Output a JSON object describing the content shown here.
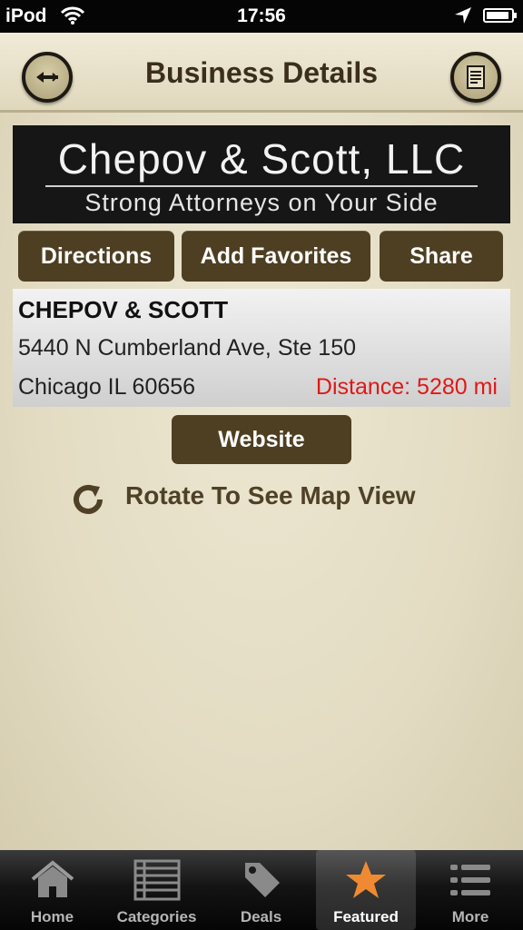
{
  "status_bar": {
    "carrier": "iPod",
    "time": "17:56",
    "wifi_icon": "wifi-icon",
    "location_icon": "location-arrow-icon",
    "battery_icon": "battery-icon"
  },
  "navbar": {
    "title": "Business Details",
    "back_icon": "back-arrow-icon",
    "notes_icon": "notes-icon"
  },
  "banner": {
    "name": "Chepov & Scott, LLC",
    "tagline": "Strong Attorneys on Your Side"
  },
  "actions": {
    "directions": "Directions",
    "add_favorites": "Add Favorites",
    "share": "Share"
  },
  "business": {
    "name": "CHEPOV & SCOTT",
    "address_line1": "5440 N Cumberland Ave, Ste 150",
    "address_line2": "Chicago IL 60656",
    "distance": "Distance: 5280 mi"
  },
  "website_label": "Website",
  "rotate_hint": "Rotate To See Map View",
  "tabs": [
    {
      "label": "Home",
      "icon": "home-icon"
    },
    {
      "label": "Categories",
      "icon": "list-grid-icon"
    },
    {
      "label": "Deals",
      "icon": "tag-icon"
    },
    {
      "label": "Featured",
      "icon": "star-icon",
      "selected": true
    },
    {
      "label": "More",
      "icon": "more-list-icon"
    }
  ],
  "colors": {
    "button_brown": "#4e3f22",
    "distance_red": "#e01818",
    "parchment": "#e8e2cd",
    "featured_star": "#f08a32"
  }
}
